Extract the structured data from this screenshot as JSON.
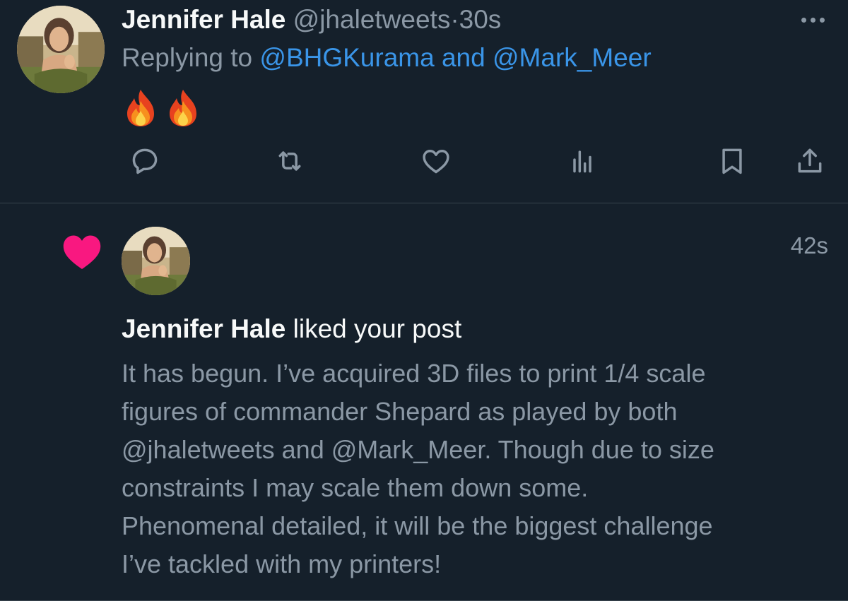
{
  "reply_tweet": {
    "author": {
      "display_name": "Jennifer Hale",
      "handle": "@jhaletweets",
      "avatar_icon": "profile-photo"
    },
    "separator": "·",
    "timestamp": "30s",
    "more_icon": "more-horizontal-icon",
    "replying_prefix": "Replying to",
    "replying_to_first": "@BHGKurama",
    "replying_conjunction": "and",
    "replying_to_second": "@Mark_Meer",
    "content_emojis": [
      "fire",
      "fire"
    ],
    "actions": [
      {
        "name": "reply",
        "icon": "reply-icon"
      },
      {
        "name": "retweet",
        "icon": "retweet-icon"
      },
      {
        "name": "like",
        "icon": "heart-outline-icon"
      },
      {
        "name": "views",
        "icon": "analytics-icon"
      },
      {
        "name": "bookmark",
        "icon": "bookmark-icon"
      },
      {
        "name": "share",
        "icon": "share-icon"
      }
    ]
  },
  "notification": {
    "type_icon": "heart-filled-icon",
    "timestamp": "42s",
    "actor_name": "Jennifer Hale",
    "action_text": "liked your post",
    "post_lines": [
      "It has begun. I’ve acquired 3D files to print 1/4 scale",
      "figures of commander Shepard as played by both",
      "@jhaletweets and @Mark_Meer. Though due to size",
      "constraints I may scale them down some.",
      "Phenomenal detailed, it will be the biggest challenge",
      "I’ve tackled with my printers!"
    ]
  },
  "colors": {
    "background": "#15202b",
    "primary_text": "#f7f9f9",
    "secondary_text": "#8b98a5",
    "link": "#3a95e8",
    "like_pink": "#f91880",
    "divider": "#38444d"
  }
}
